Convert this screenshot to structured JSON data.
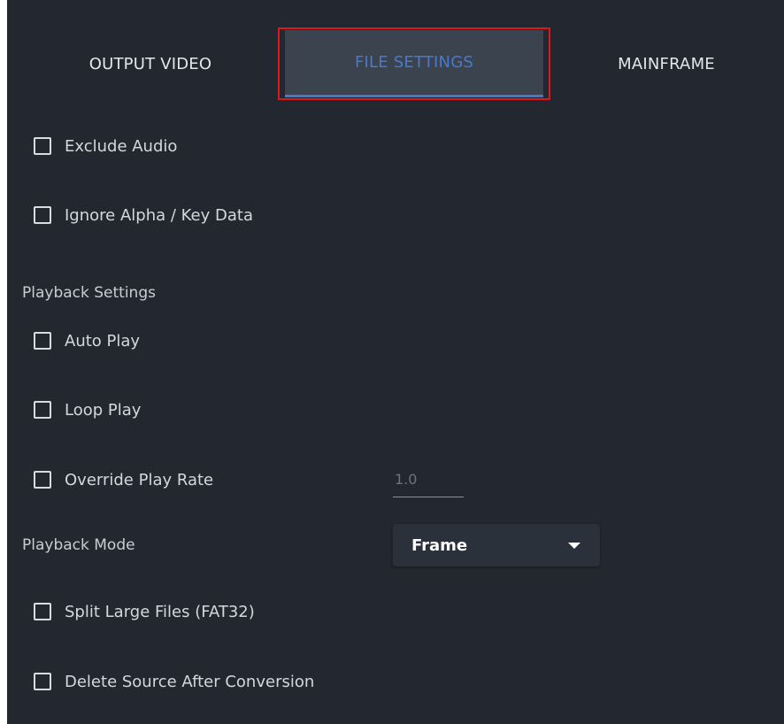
{
  "tabs": [
    {
      "label": "OUTPUT VIDEO"
    },
    {
      "label": "FILE SETTINGS"
    },
    {
      "label": "MAINFRAME"
    }
  ],
  "options": {
    "exclude_audio": "Exclude Audio",
    "ignore_alpha": "Ignore Alpha / Key Data",
    "auto_play": "Auto Play",
    "loop_play": "Loop Play",
    "override_play_rate": "Override Play Rate",
    "split_large_files": "Split Large Files (FAT32)",
    "delete_source": "Delete Source After Conversion"
  },
  "sections": {
    "playback_settings": "Playback Settings",
    "playback_mode": "Playback Mode"
  },
  "play_rate": {
    "placeholder": "1.0"
  },
  "playback_mode": {
    "selected": "Frame"
  },
  "colors": {
    "background": "#232830",
    "active_tab_bg": "#3b434e",
    "accent": "#4c74c7",
    "highlight_box": "#e0161c"
  }
}
